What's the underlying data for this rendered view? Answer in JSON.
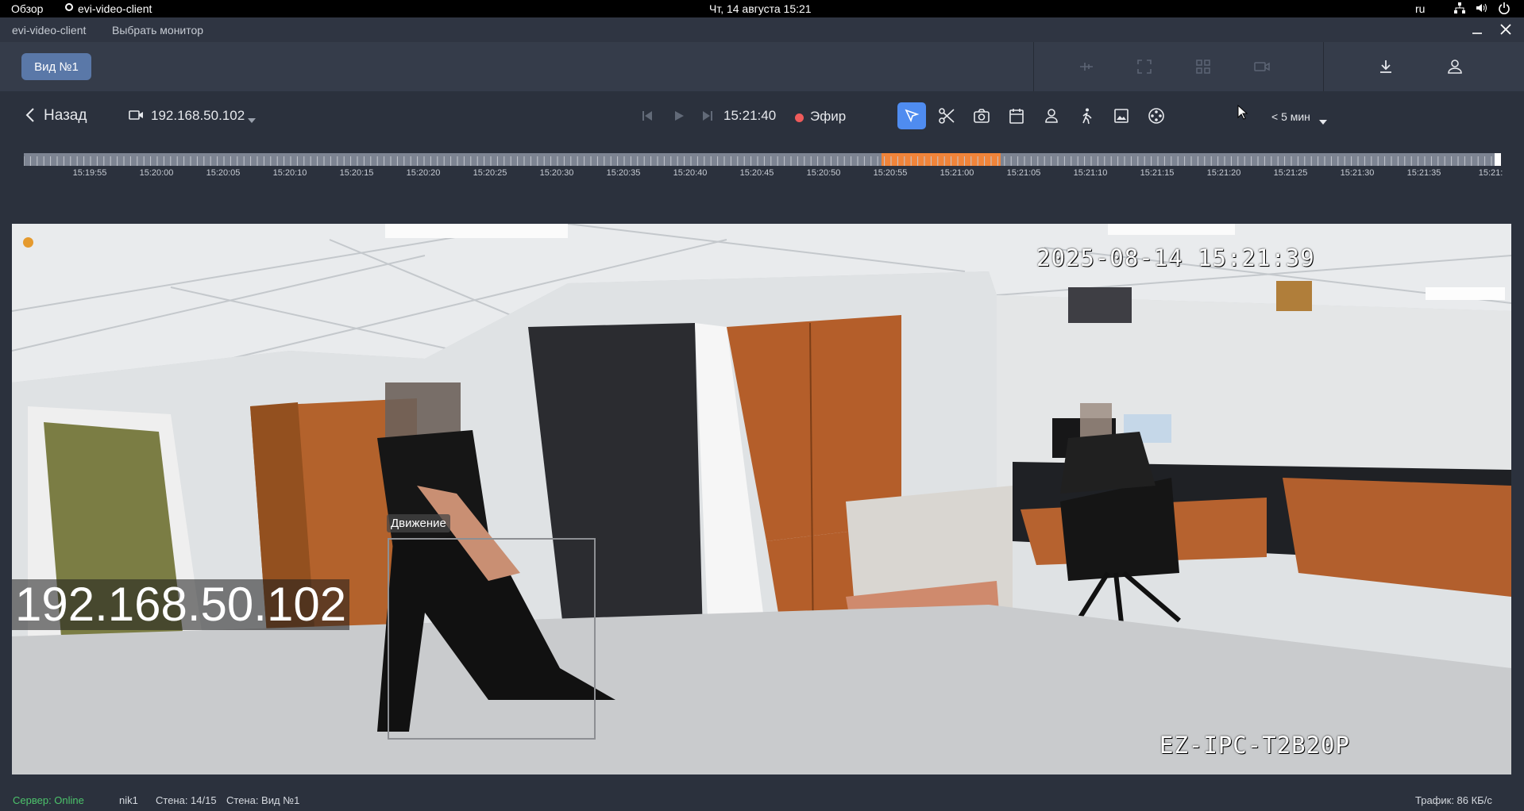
{
  "os_bar": {
    "overview": "Обзор",
    "app_name": "evi-video-client",
    "datetime": "Чт, 14 августа  15:21",
    "lang": "ru"
  },
  "title_bar": {
    "app": "evi-video-client",
    "select_monitor": "Выбрать монитор"
  },
  "view_bar": {
    "view_button": "Вид №1"
  },
  "playback": {
    "back_label": "Назад",
    "camera": "192.168.50.102",
    "time": "15:21:40",
    "live_label": "Эфир",
    "range": "< 5 мин"
  },
  "timeline": {
    "labels": [
      "15:19:55",
      "15:20:00",
      "15:20:05",
      "15:20:10",
      "15:20:15",
      "15:20:20",
      "15:20:25",
      "15:20:30",
      "15:20:35",
      "15:20:40",
      "15:20:45",
      "15:20:50",
      "15:20:55",
      "15:21:00",
      "15:21:05",
      "15:21:10",
      "15:21:15",
      "15:21:20",
      "15:21:25",
      "15:21:30",
      "15:21:35",
      "15:21:"
    ],
    "event_color": "#f0843a",
    "track_color": "#7d8492"
  },
  "video": {
    "osd_timestamp": "2025-08-14  15:21:39",
    "osd_model": "EZ-IPC-T2B20P",
    "camera_overlay": "192.168.50.102",
    "detection_label": "Движение"
  },
  "status_bar": {
    "server": "Сервер: Online",
    "user": "nik1",
    "wall_count": "Стена: 14/15",
    "wall_name": "Стена: Вид №1",
    "traffic": "Трафик: 86 КБ/с"
  },
  "colors": {
    "accent": "#5a8df0",
    "live_dot": "#ef5b5b",
    "online": "#4cc36b"
  }
}
